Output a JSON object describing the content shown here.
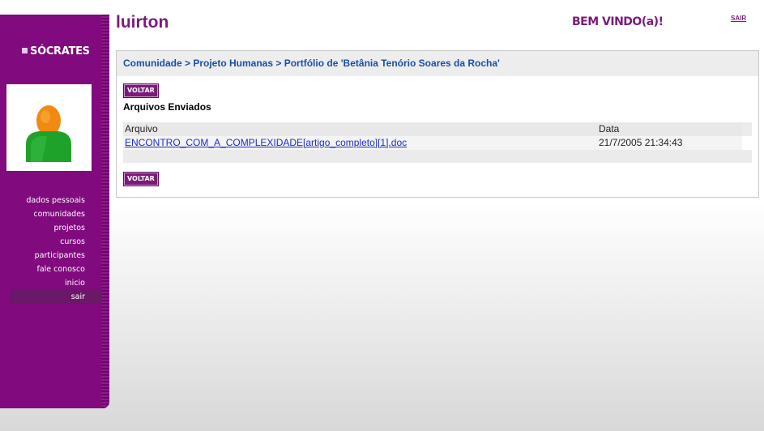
{
  "sidebar": {
    "logo_text": "SÓCRATES",
    "nav_items": [
      {
        "label": "dados pessoais"
      },
      {
        "label": "comunidades"
      },
      {
        "label": "projetos"
      },
      {
        "label": "cursos"
      },
      {
        "label": "participantes"
      },
      {
        "label": "fale conosco"
      },
      {
        "label": "inicio"
      },
      {
        "label": "sair",
        "active": true
      }
    ]
  },
  "header": {
    "user_name": "luirton",
    "welcome": "BEM VINDO(a)!",
    "logout_label": "SAIR"
  },
  "main": {
    "breadcrumb": "Comunidade > Projeto Humanas > Portfólio de 'Betânia Tenório Soares da Rocha'",
    "back_label": "VOLTAR",
    "section_title": "Arquivos Enviados",
    "table": {
      "columns": [
        "Arquivo",
        "Data"
      ],
      "rows": [
        {
          "file": "ENCONTRO_COM_A_COMPLEXIDADE[artigo_completo][1].doc",
          "date": "21/7/2005 21:34:43"
        }
      ]
    }
  },
  "colors": {
    "sidebar": "#800a7e",
    "accent": "#7a1b7a",
    "link": "#1a2fc7",
    "breadcrumb": "#174ea6"
  },
  "icons": [
    "avatar-icon",
    "logo-square-icon"
  ]
}
